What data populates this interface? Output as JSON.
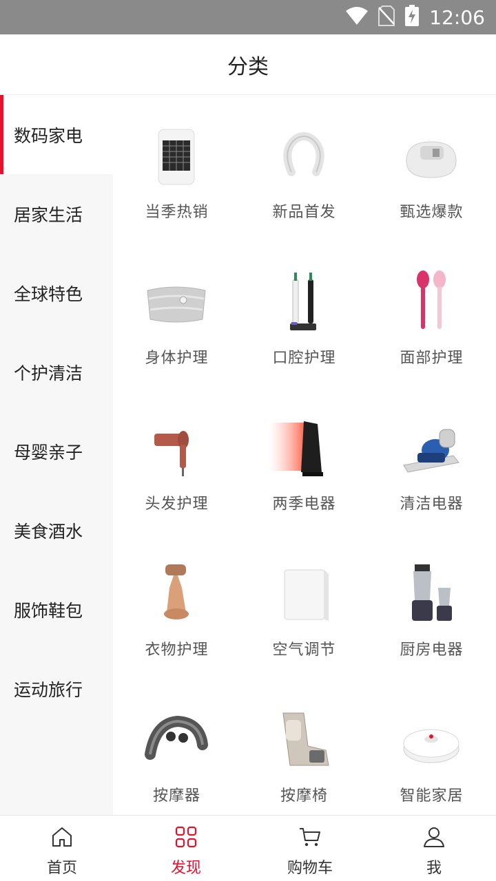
{
  "status_bar": {
    "time": "12:06",
    "icons": [
      "wifi-icon",
      "no-sim-icon",
      "battery-charging-icon"
    ]
  },
  "header": {
    "title": "分类"
  },
  "sidebar": {
    "items": [
      {
        "label": "数码家电",
        "active": true
      },
      {
        "label": "居家生活"
      },
      {
        "label": "全球特色"
      },
      {
        "label": "个护清洁"
      },
      {
        "label": "母婴亲子"
      },
      {
        "label": "美食酒水"
      },
      {
        "label": "服饰鞋包"
      },
      {
        "label": "运动旅行"
      }
    ]
  },
  "grid": {
    "items": [
      {
        "label": "当季热销",
        "icon": "heater-icon"
      },
      {
        "label": "新品首发",
        "icon": "neck-massager-icon"
      },
      {
        "label": "甄选爆款",
        "icon": "foot-massager-icon"
      },
      {
        "label": "身体护理",
        "icon": "waist-belt-icon"
      },
      {
        "label": "口腔护理",
        "icon": "electric-toothbrush-icon"
      },
      {
        "label": "面部护理",
        "icon": "face-brush-icon"
      },
      {
        "label": "头发护理",
        "icon": "hair-dryer-icon"
      },
      {
        "label": "两季电器",
        "icon": "tower-heater-icon"
      },
      {
        "label": "清洁电器",
        "icon": "mite-vacuum-icon"
      },
      {
        "label": "衣物护理",
        "icon": "garment-steamer-icon"
      },
      {
        "label": "空气调节",
        "icon": "air-purifier-icon"
      },
      {
        "label": "厨房电器",
        "icon": "blender-icon"
      },
      {
        "label": "按摩器",
        "icon": "shoulder-massager-icon"
      },
      {
        "label": "按摩椅",
        "icon": "massage-chair-icon"
      },
      {
        "label": "智能家居",
        "icon": "robot-vacuum-icon"
      }
    ]
  },
  "tabbar": {
    "accent": "#e8102c",
    "items": [
      {
        "label": "首页",
        "icon": "home-icon"
      },
      {
        "label": "发现",
        "icon": "grid-icon",
        "active": true
      },
      {
        "label": "购物车",
        "icon": "cart-icon"
      },
      {
        "label": "我",
        "icon": "user-icon"
      }
    ]
  }
}
